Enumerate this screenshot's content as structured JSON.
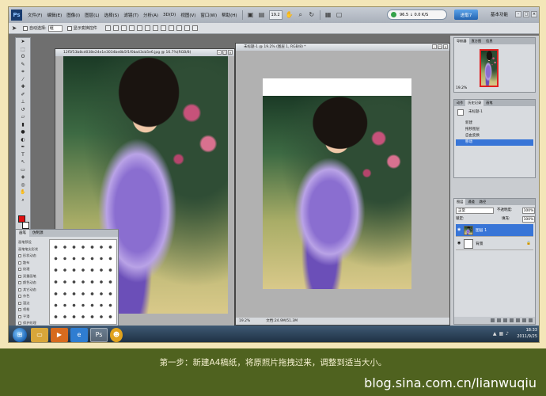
{
  "menubar": {
    "logo": "Ps",
    "items": [
      "文件(F)",
      "编辑(E)",
      "图像(I)",
      "图层(L)",
      "选择(S)",
      "滤镜(T)",
      "分析(A)",
      "3D(D)",
      "视图(V)",
      "窗口(W)",
      "帮助(H)"
    ],
    "zoom": "19.2",
    "net_meter": "96.5 ↓ 0.0 K/S",
    "qq_button": "进取7",
    "workspace": "基本功能"
  },
  "options_bar": {
    "auto_select": "自动选择:",
    "auto_select_value": "组",
    "show_transform": "显示变换控件"
  },
  "doc1": {
    "title": "12f5f53b8cd038e24e1e3034be8b5f1f0ba43cb5e6.jpg @ 16.7%(RGB/8)"
  },
  "doc2": {
    "title": "未标题-1 @ 19.2% (图层 1, RGB/8) *",
    "zoom": "19.2%",
    "doc_size": "文档:24.9M/51.3M"
  },
  "brush_panel": {
    "tabs": [
      "画笔",
      "仿制源"
    ],
    "items": [
      "画笔预设",
      "画笔笔尖形状",
      "形状动态",
      "散布",
      "纹理",
      "双重画笔",
      "颜色动态",
      "其它动态",
      "杂色",
      "湿边",
      "喷枪",
      "平滑",
      "保护纹理"
    ]
  },
  "navigator_panel": {
    "tabs": [
      "导航器",
      "直方图",
      "信息"
    ],
    "zoom": "19.2%"
  },
  "history_panel": {
    "tabs": [
      "动作",
      "历史记录",
      "画笔"
    ],
    "snapshot": "未标题-1",
    "items": [
      "新建",
      "拖移图层",
      "自由变换",
      "移动"
    ]
  },
  "layers_panel": {
    "tabs": [
      "图层",
      "通道",
      "路径"
    ],
    "mode": "正常",
    "opacity_label": "不透明度:",
    "opacity": "100%",
    "lock_label": "锁定:",
    "fill_label": "填充:",
    "fill": "100%",
    "layers": [
      {
        "name": "图层 1",
        "selected": true
      },
      {
        "name": "背景",
        "selected": false
      }
    ]
  },
  "taskbar": {
    "time": "18:33",
    "date": "2011/9/25"
  },
  "caption": "第一步：新建A4稿纸，将原照片拖拽过来，调整到适当大小。",
  "watermark": "blog.sina.com.cn/lianwuqiu"
}
